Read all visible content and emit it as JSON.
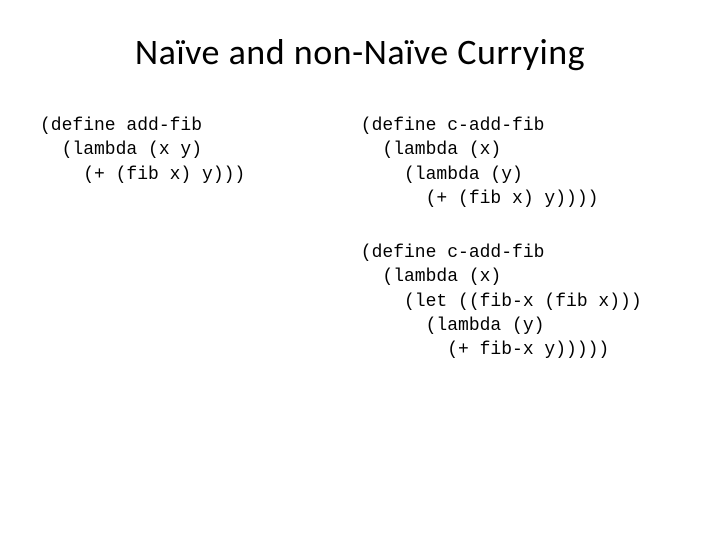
{
  "slide": {
    "title": "Naïve and non-Naïve Currying",
    "left": {
      "code1": "(define add-fib\n  (lambda (x y)\n    (+ (fib x) y)))"
    },
    "right": {
      "code1": "(define c-add-fib\n  (lambda (x)\n    (lambda (y)\n      (+ (fib x) y))))",
      "code2": "(define c-add-fib\n  (lambda (x)\n    (let ((fib-x (fib x)))\n      (lambda (y)\n        (+ fib-x y)))))"
    }
  }
}
